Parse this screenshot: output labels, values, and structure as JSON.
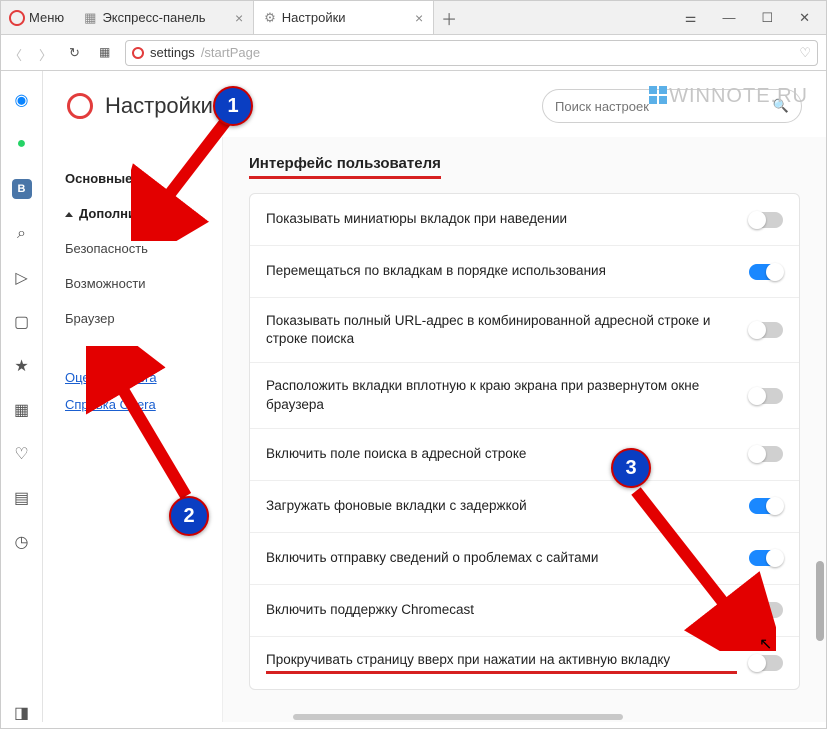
{
  "titlebar": {
    "menu_label": "Меню",
    "tabs": [
      {
        "title": "Экспресс-панель",
        "icon": "speed-dial-icon",
        "active": false
      },
      {
        "title": "Настройки",
        "icon": "gear-icon",
        "active": true
      }
    ]
  },
  "addressbar": {
    "url_host": "settings",
    "url_path": "/startPage"
  },
  "rail": {
    "icons": [
      "messenger-icon",
      "whatsapp-icon",
      "vk-icon",
      "search-icon",
      "send-icon",
      "camera-icon",
      "bookmarks-icon",
      "grid-icon",
      "heart-icon",
      "news-icon",
      "clock-icon"
    ],
    "bottom_icon": "sidebar-toggle-icon"
  },
  "page": {
    "title": "Настройки",
    "search_placeholder": "Поиск настроек"
  },
  "sidenav": {
    "items": [
      {
        "label": "Основные",
        "kind": "item"
      },
      {
        "label": "Дополнительно",
        "kind": "expander",
        "expanded": true
      },
      {
        "label": "Безопасность",
        "kind": "item"
      },
      {
        "label": "Возможности",
        "kind": "item"
      },
      {
        "label": "Браузер",
        "kind": "item"
      }
    ],
    "links": [
      {
        "label": "Оценить Opera"
      },
      {
        "label": "Справка Opera"
      }
    ]
  },
  "settings": {
    "section_title": "Интерфейс пользователя",
    "rows": [
      {
        "label": "Показывать миниатюры вкладок при наведении",
        "on": false
      },
      {
        "label": "Перемещаться по вкладкам в порядке использования",
        "on": true
      },
      {
        "label": "Показывать полный URL-адрес в комбинированной адресной строке и строке поиска",
        "on": false
      },
      {
        "label": "Расположить вкладки вплотную к краю экрана при развернутом окне браузера",
        "on": false
      },
      {
        "label": "Включить поле поиска в адресной строке",
        "on": false
      },
      {
        "label": "Загружать фоновые вкладки с задержкой",
        "on": true
      },
      {
        "label": "Включить отправку сведений о проблемах с сайтами",
        "on": true
      },
      {
        "label": "Включить поддержку Chromecast",
        "on": false
      },
      {
        "label": "Прокручивать страницу вверх при нажатии на активную вкладку",
        "on": false,
        "highlight": true
      }
    ]
  },
  "annotations": {
    "watermark": "WINNOTE.RU",
    "circles": {
      "1": "1",
      "2": "2",
      "3": "3"
    }
  }
}
